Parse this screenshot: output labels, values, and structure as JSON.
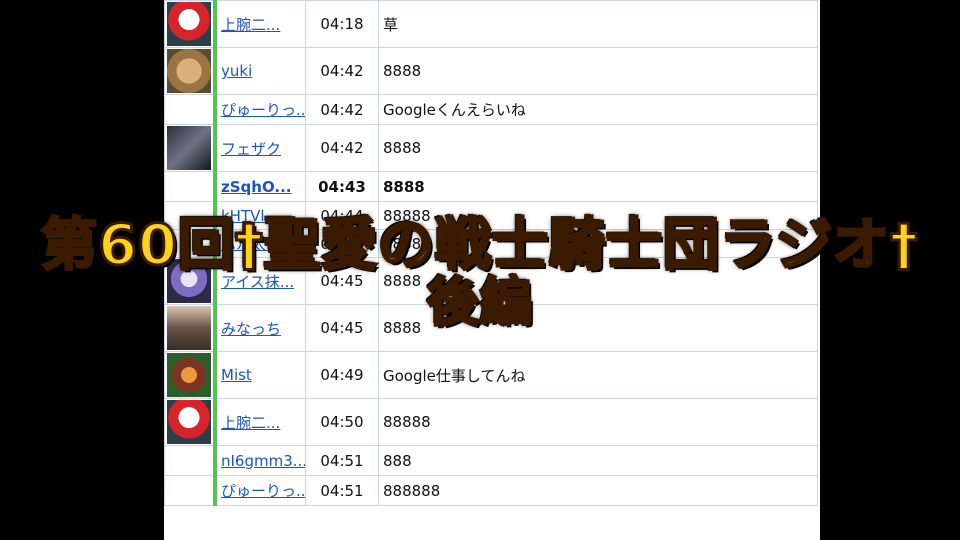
{
  "title": {
    "main": "第60回†聖愛の戦士騎士団ラジオ†",
    "sub": "後編"
  },
  "comments": [
    {
      "avatar": "pokeball-avatar",
      "name": "上腕二...",
      "time": "04:18",
      "text": "草"
    },
    {
      "avatar": "cat-avatar",
      "name": "yuki",
      "time": "04:42",
      "text": "8888"
    },
    {
      "avatar": "",
      "name": "ぴゅーりっ...",
      "time": "04:42",
      "text": "Googleくんえらいね"
    },
    {
      "avatar": "dark-figure-avatar",
      "name": "フェザク",
      "time": "04:42",
      "text": "8888"
    },
    {
      "avatar": "",
      "name": "zSqhO...",
      "time": "04:43",
      "text": "8888"
    },
    {
      "avatar": "",
      "name": "kHTVl...",
      "time": "04:44",
      "text": "88888"
    },
    {
      "avatar": "",
      "name": "ハル太...",
      "time": "04:44",
      "text": "8888"
    },
    {
      "avatar": "anime-girl-avatar",
      "name": "アイス抹...",
      "time": "04:45",
      "text": "8888"
    },
    {
      "avatar": "photo-avatar",
      "name": "みなっち",
      "time": "04:45",
      "text": "8888"
    },
    {
      "avatar": "mist-avatar",
      "name": "Mist",
      "time": "04:49",
      "text": "Google仕事してんね"
    },
    {
      "avatar": "pokeball-avatar",
      "name": "上腕二...",
      "time": "04:50",
      "text": "88888"
    },
    {
      "avatar": "",
      "name": "nI6gmm3...",
      "time": "04:51",
      "text": "888"
    },
    {
      "avatar": "",
      "name": "ぴゅーりっ...",
      "time": "04:51",
      "text": "888888"
    }
  ],
  "colors": {
    "accent_bar": "#4fc64f",
    "link": "#1a55c8",
    "title_fill": "#ffd21a"
  }
}
